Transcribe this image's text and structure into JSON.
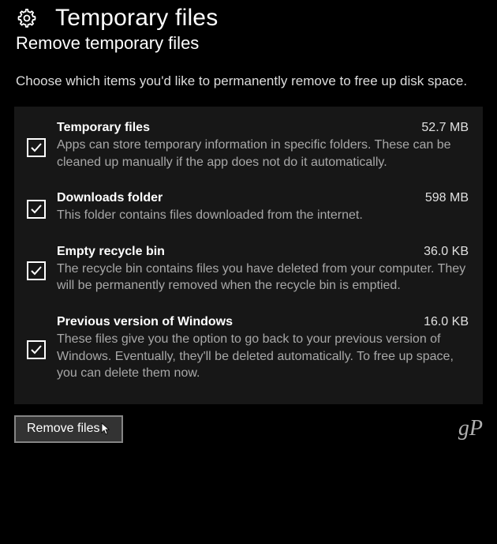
{
  "header": {
    "title": "Temporary files",
    "subtitle": "Remove temporary files",
    "description": "Choose which items you'd like to permanently remove to free up disk space."
  },
  "items": [
    {
      "title": "Temporary files",
      "size": "52.7 MB",
      "description": "Apps can store temporary information in specific folders. These can be cleaned up manually if the app does not do it automatically.",
      "checked": true
    },
    {
      "title": "Downloads folder",
      "size": "598 MB",
      "description": "This folder contains files downloaded from the internet.",
      "checked": true
    },
    {
      "title": "Empty recycle bin",
      "size": "36.0 KB",
      "description": "The recycle bin contains files you have deleted from your computer. They will be permanently removed when the recycle bin is emptied.",
      "checked": true
    },
    {
      "title": "Previous version of Windows",
      "size": "16.0 KB",
      "description": "These files give you the option to go back to your previous version of Windows. Eventually, they'll be deleted automatically. To free up space, you can delete them now.",
      "checked": true
    }
  ],
  "actions": {
    "remove_label": "Remove files"
  },
  "watermark": "gP"
}
